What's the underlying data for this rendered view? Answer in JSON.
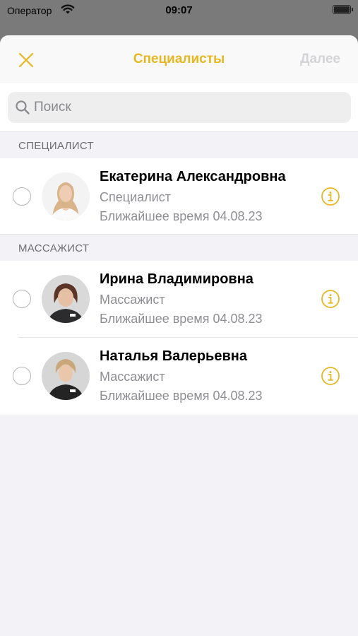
{
  "status_bar": {
    "carrier": "Оператор",
    "time": "09:07"
  },
  "nav": {
    "title": "Специалисты",
    "next_label": "Далее"
  },
  "search": {
    "placeholder": "Поиск"
  },
  "colors": {
    "accent": "#e5b823",
    "disabled": "#d4d4d8",
    "secondary_text": "#8e8e93"
  },
  "sections": [
    {
      "header": "СПЕЦИАЛИСТ",
      "items": [
        {
          "name": "Екатерина Александровна",
          "role": "Специалист",
          "nearest": "Ближайшее время 04.08.23"
        }
      ]
    },
    {
      "header": "МАССАЖИСТ",
      "items": [
        {
          "name": "Ирина Владимировна",
          "role": "Массажист",
          "nearest": "Ближайшее время 04.08.23"
        },
        {
          "name": "Наталья Валерьевна",
          "role": "Массажист",
          "nearest": "Ближайшее время 04.08.23"
        }
      ]
    }
  ]
}
